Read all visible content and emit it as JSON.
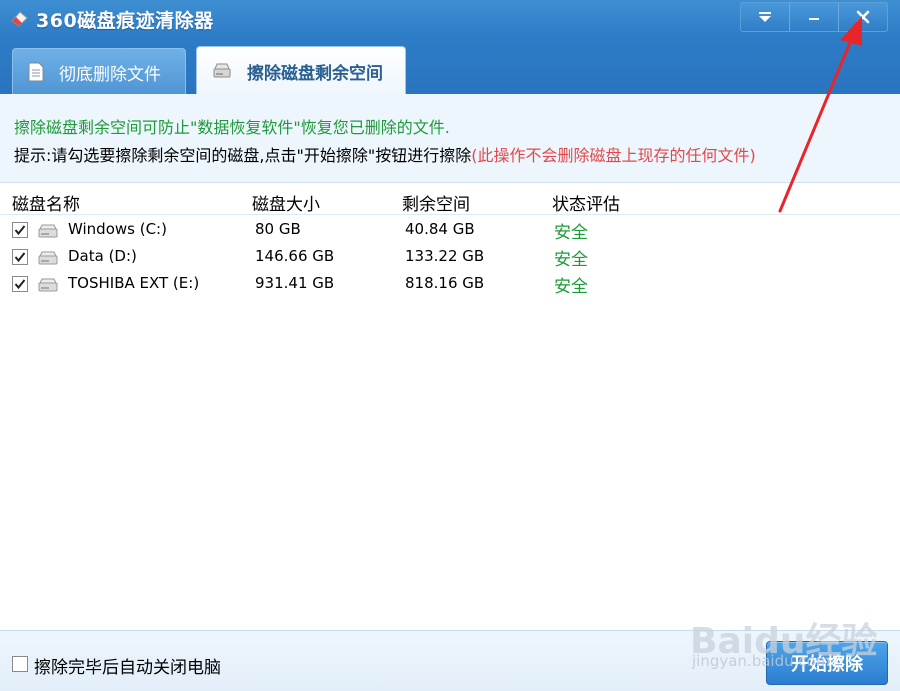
{
  "app": {
    "title": "360磁盘痕迹清除器"
  },
  "window_controls": {
    "menu_glyph": "▾",
    "minimize_glyph": "–",
    "close_glyph": "✕"
  },
  "tabs": [
    {
      "label": "彻底删除文件",
      "icon": "document-icon",
      "active": false
    },
    {
      "label": "擦除磁盘剩余空间",
      "icon": "drive-icon",
      "active": true
    }
  ],
  "info": {
    "line1": "擦除磁盘剩余空间可防止\"数据恢复软件\"恢复您已删除的文件.",
    "line2_main": "提示:请勾选要擦除剩余空间的磁盘,点击\"开始擦除\"按钮进行擦除",
    "line2_warning": "(此操作不会删除磁盘上现存的任何文件)"
  },
  "table": {
    "headers": [
      "磁盘名称",
      "磁盘大小",
      "剩余空间",
      "状态评估"
    ],
    "rows": [
      {
        "checked": true,
        "name": "Windows (C:)",
        "size": "80 GB",
        "free": "40.84 GB",
        "status": "安全"
      },
      {
        "checked": true,
        "name": "Data (D:)",
        "size": "146.66 GB",
        "free": "133.22 GB",
        "status": "安全"
      },
      {
        "checked": true,
        "name": "TOSHIBA EXT (E:)",
        "size": "931.41 GB",
        "free": "818.16 GB",
        "status": "安全"
      }
    ]
  },
  "footer": {
    "shutdown_checked": false,
    "shutdown_label": "擦除完毕后自动关闭电脑",
    "start_button": "开始擦除"
  },
  "watermark": {
    "main": "Baidu经验",
    "sub": "jingyan.baidu.com"
  },
  "colors": {
    "titlebar": "#2d7cc6",
    "safe_status": "#1e9a3a",
    "warning_text": "#e0494a",
    "annotation_arrow": "#e8262a"
  }
}
